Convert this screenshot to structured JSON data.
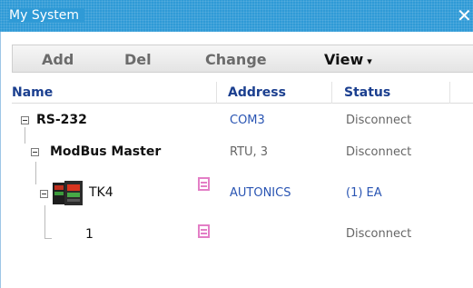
{
  "window": {
    "title": "My System",
    "close_glyph": "✕"
  },
  "toolbar": {
    "add_label": "Add",
    "del_label": "Del",
    "change_label": "Change",
    "view_label": "View",
    "view_chevron": "▾"
  },
  "columns": {
    "name": "Name",
    "address": "Address",
    "status": "Status"
  },
  "tree": {
    "rs232": {
      "name": "RS-232",
      "address": "COM3",
      "status": "Disconnect"
    },
    "modbus": {
      "name": "ModBus Master",
      "address": "RTU, 3",
      "status": "Disconnect"
    },
    "tk4": {
      "name": "TK4",
      "address": "AUTONICS",
      "status": "(1) EA"
    },
    "item1": {
      "name": "1",
      "address": "",
      "status": "Disconnect"
    }
  },
  "colors": {
    "title_bar": "#2f9ad6",
    "header_text": "#1b3f8f",
    "address_text": "#2a55b3",
    "memory_icon": "#e37ec6"
  },
  "icons": [
    "close-icon",
    "collapse-icon",
    "device-icon",
    "memory-icon",
    "chevron-down-icon"
  ]
}
